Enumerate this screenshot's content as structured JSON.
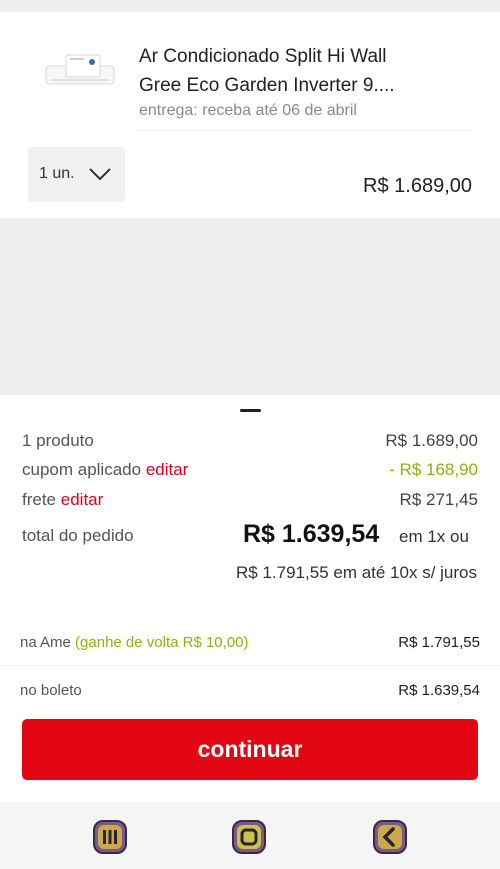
{
  "product": {
    "title_line1": "Ar Condicionado Split Hi Wall",
    "title_line2": "Gree Eco Garden Inverter 9....",
    "delivery": "entrega: receba até 06 de abril",
    "quantity": "1 un.",
    "price": "R$ 1.689,00"
  },
  "summary": {
    "products_label": "1 produto",
    "products_value": "R$ 1.689,00",
    "coupon_label": "cupom aplicado",
    "coupon_edit": "editar",
    "coupon_value": "- R$ 168,90",
    "shipping_label": "frete",
    "shipping_edit": "editar",
    "shipping_value": "R$ 271,45",
    "total_label": "total do pedido",
    "total_value": "R$ 1.639,54",
    "total_suffix": "em 1x ou",
    "installments": "R$ 1.791,55 em até 10x s/ juros"
  },
  "payment": {
    "ame_label": "na Ame",
    "ame_cashback": "(ganhe de volta R$ 10,00)",
    "ame_value": "R$ 1.791,55",
    "boleto_label": "no boleto",
    "boleto_value": "R$ 1.639,54"
  },
  "actions": {
    "continue_label": "continuar"
  },
  "colors": {
    "accent": "#e30613",
    "discount": "#8cb40c",
    "link": "#e2001a"
  },
  "nav": {
    "icons": [
      "recent-apps-icon",
      "home-icon",
      "back-icon"
    ]
  }
}
